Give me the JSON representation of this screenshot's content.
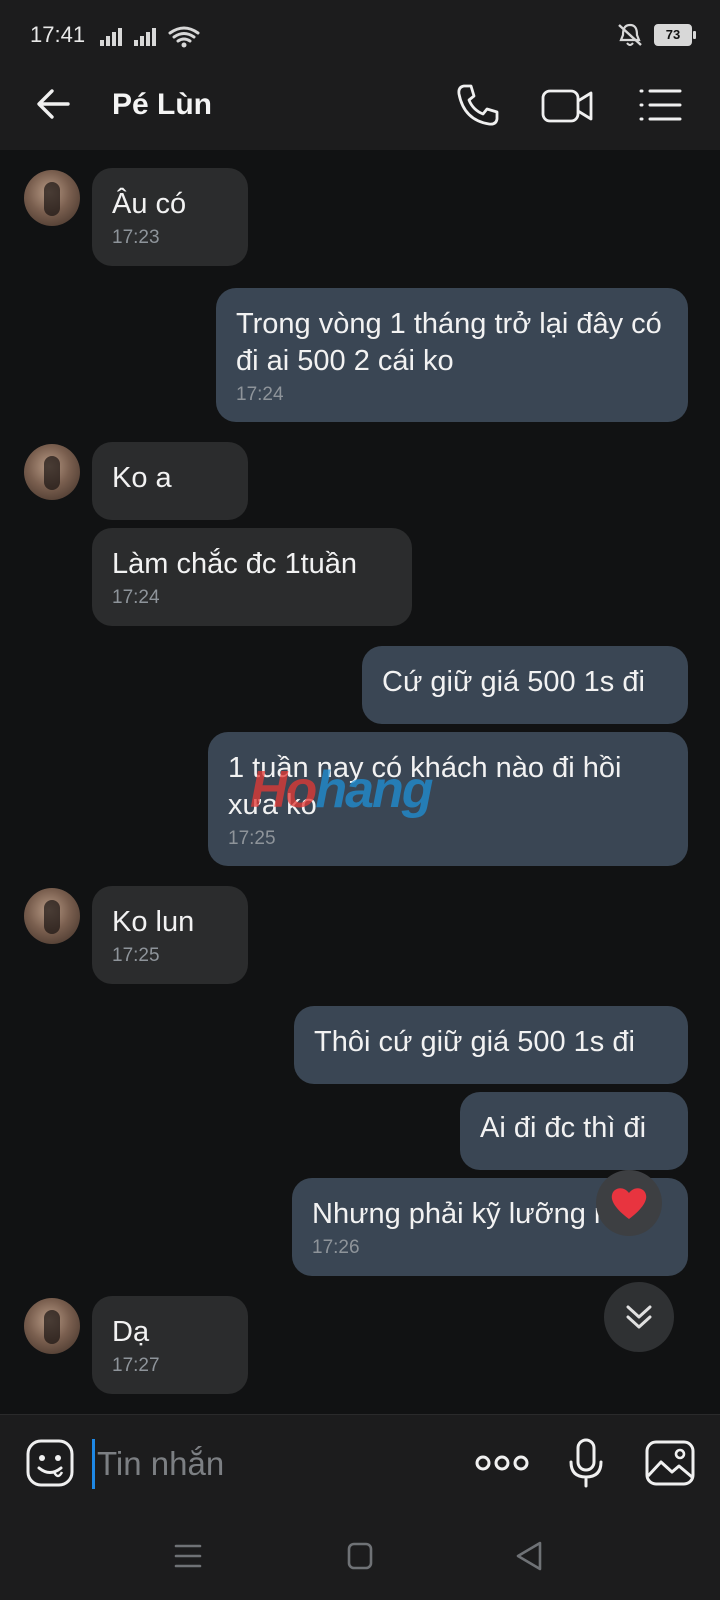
{
  "status_bar": {
    "time": "17:41",
    "battery": "73",
    "icons": [
      "signal-icon",
      "signal-icon",
      "wifi-icon",
      "mute-bell-icon",
      "battery-icon"
    ]
  },
  "header": {
    "title": "Pé Lùn",
    "icons": [
      "back-arrow-icon",
      "phone-icon",
      "video-camera-icon",
      "menu-list-icon"
    ]
  },
  "messages": [
    {
      "side": "in",
      "text": "Âu có",
      "time": "17:23",
      "avatar": true
    },
    {
      "side": "out",
      "text": "Trong vòng 1 tháng trở lại đây có đi ai 500 2 cái ko",
      "time": "17:24"
    },
    {
      "side": "in",
      "text": "Ko a",
      "time": "",
      "avatar": true
    },
    {
      "side": "in",
      "text": "Làm chắc đc 1tuần",
      "time": "17:24"
    },
    {
      "side": "out",
      "text": "Cứ giữ giá 500 1s đi",
      "time": ""
    },
    {
      "side": "out",
      "text": "1 tuần nay có khách nào đi hồi xưa ko",
      "time": "17:25"
    },
    {
      "side": "in",
      "text": "Ko lun",
      "time": "17:25",
      "avatar": true
    },
    {
      "side": "out",
      "text": "Thôi cứ giữ giá 500 1s đi",
      "time": ""
    },
    {
      "side": "out",
      "text": "Ai đi đc thì đi",
      "time": ""
    },
    {
      "side": "out",
      "text": "Nhưng phải kỹ lưỡng nha",
      "time": "17:26",
      "reaction": "heart-icon"
    },
    {
      "side": "in",
      "text": "Dạ",
      "time": "17:27",
      "avatar": true
    }
  ],
  "watermark": {
    "part1": "Ho",
    "part2": "hang"
  },
  "composer": {
    "placeholder": "Tin nhắn",
    "icons": [
      "emoji-icon",
      "more-icon",
      "microphone-icon",
      "image-icon"
    ]
  },
  "colors": {
    "background": "#111213",
    "bar": "#1c1c1d",
    "incoming_bubble": "#2b2c2d",
    "outgoing_bubble": "#3a4654",
    "cursor": "#1e88e5"
  }
}
